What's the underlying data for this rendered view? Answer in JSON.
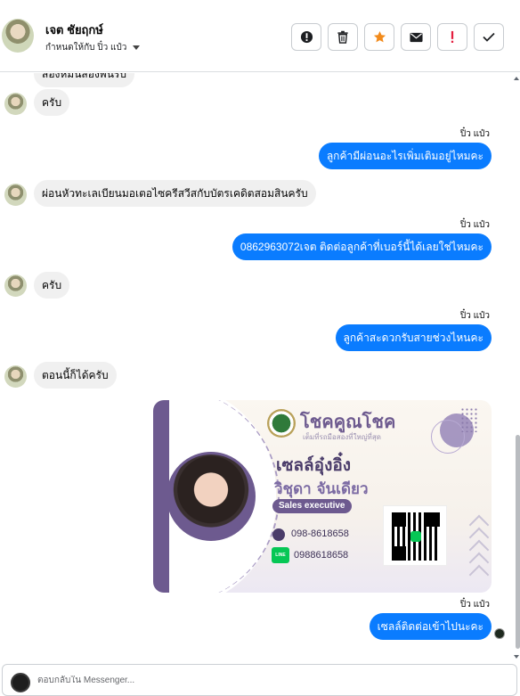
{
  "header": {
    "contact_name": "เจต ชัยฤกษ์",
    "assigned_label": "กำหนดให้กับ ปิ๋ว แป๋ว",
    "actions": [
      {
        "name": "mark-spam-button",
        "icon": "exclamation-circle-icon"
      },
      {
        "name": "delete-button",
        "icon": "trash-icon"
      },
      {
        "name": "star-button",
        "icon": "star-icon"
      },
      {
        "name": "mark-unread-button",
        "icon": "envelope-icon"
      },
      {
        "name": "follow-up-button",
        "icon": "exclamation-icon"
      },
      {
        "name": "mark-done-button",
        "icon": "check-icon"
      }
    ]
  },
  "thread": {
    "messages": [
      {
        "direction": "in",
        "text": "สองหมื่นสองพันรับ"
      },
      {
        "direction": "in",
        "text": "ครับ"
      },
      {
        "direction": "out",
        "sender": "ปิ๋ว แป๋ว",
        "text": "ลูกค้ามีผ่อนอะไรเพิ่มเติมอยู่ไหมคะ"
      },
      {
        "direction": "in",
        "text": "ผ่อนหัวทะเลเบียนมอเตอไซครีสวีสกับบัตรเคดิตสอมสินครับ"
      },
      {
        "direction": "out",
        "sender": "ปิ๋ว แป๋ว",
        "text": "0862963072เจต   ติดต่อลูกค้าที่เบอร์นี้ได้เลยใช่ไหมคะ"
      },
      {
        "direction": "in",
        "text": "ครับ"
      },
      {
        "direction": "out",
        "sender": "ปิ๋ว แป๋ว",
        "text": "ลูกค้าสะดวกรับสายช่วงไหนคะ"
      },
      {
        "direction": "in",
        "text": "ตอนนี้ก็ได้ครับ"
      },
      {
        "direction": "out",
        "sender": "ปิ๋ว แป๋ว",
        "text": "เซลล์ติดต่อเข้าไปนะคะ"
      }
    ]
  },
  "card": {
    "brand_title": "โชคคูณโชค",
    "brand_subtitle": "เต็มที่รถมือสองที่ใหญ่ที่สุด",
    "nickname": "เซลล์อุ๋งอิ๋ง",
    "full_name": "วิชุดา จันเดียว",
    "role": "Sales executive",
    "phone": "098-8618658",
    "line_badge": "LINE",
    "line_id": "0988618658"
  },
  "composer": {
    "placeholder": "ตอบกลับใน Messenger..."
  },
  "colors": {
    "outgoing_bubble": "#0a7cff",
    "incoming_bubble": "#f0f0f0",
    "card_accent": "#6d5a8f",
    "star_icon": "#f28b1c",
    "alert_icon": "#e41e3f"
  }
}
